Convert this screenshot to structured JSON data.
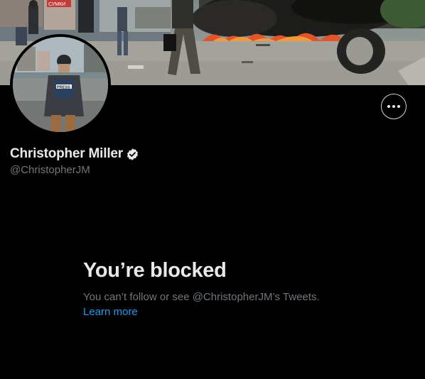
{
  "profile": {
    "display_name": "Christopher Miller",
    "handle": "@ChristopherJM",
    "verified": true
  },
  "banner": {
    "image_description_icon": "street-fire-photo",
    "shop_sign_text": "СУМКИ"
  },
  "avatar": {
    "vest_text": "PRESS"
  },
  "actions": {
    "more_icon": "more-horizontal-icon"
  },
  "blocked": {
    "title": "You’re blocked",
    "description": "You can’t follow or see @ChristopherJM’s Tweets.",
    "learn_more": "Learn more"
  },
  "colors": {
    "background": "#000000",
    "primary_text": "#e7e9ea",
    "secondary_text": "#71767b",
    "link": "#1d9bf0"
  }
}
